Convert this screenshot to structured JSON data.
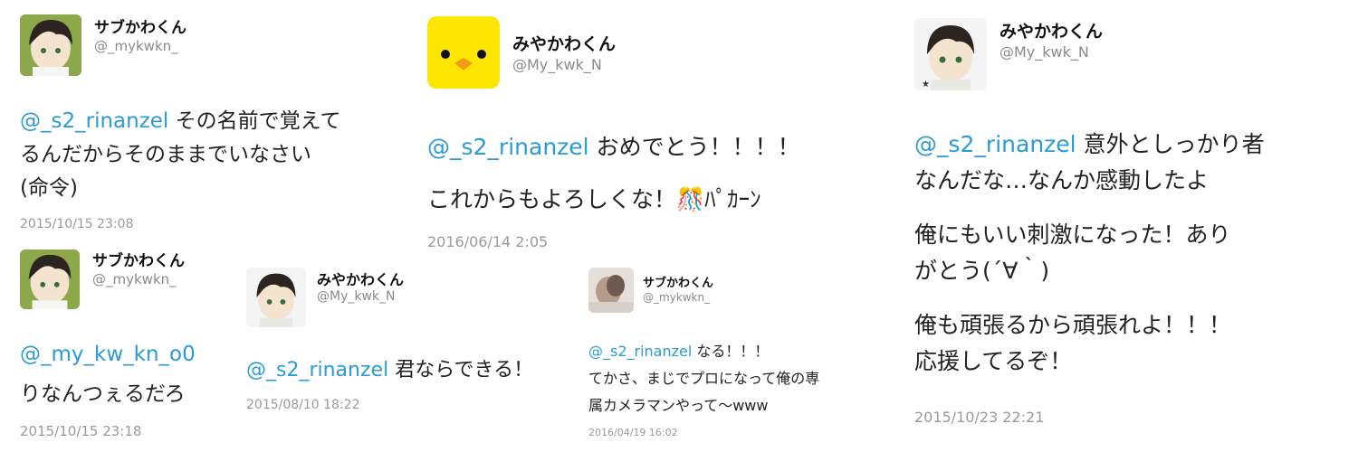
{
  "tweets": [
    {
      "name": "サブかわくん",
      "handle": "@_mykwkn_",
      "avatar": "anime-boy-avatar-green",
      "mention": "@_s2_rinanzel",
      "lines": [
        "その名前で覚えて",
        "るんだからそのままでいなさい",
        "(命令)"
      ],
      "timestamp": "2015/10/15 23:08"
    },
    {
      "name": "みやかわくん",
      "handle": "@My_kwk_N",
      "avatar": "yellow-chick-avatar",
      "mention": "@_s2_rinanzel",
      "lines": [
        "おめでとう！！！！",
        "これからもよろしくな！🎊ﾊﾟｶｰﾝ"
      ],
      "timestamp": "2016/06/14 2:05"
    },
    {
      "name": "みやかわくん",
      "handle": "@My_kwk_N",
      "avatar": "anime-boy-avatar-white",
      "mention": "@_s2_rinanzel",
      "paragraphs": [
        [
          "意外としっかり者",
          "なんだな…なんか感動したよ"
        ],
        [
          "俺にもいい刺激になった！あり",
          "がとう(´∀｀)"
        ],
        [
          "俺も頑張るから頑張れよ！！！",
          "応援してるぞ！"
        ]
      ],
      "timestamp": "2015/10/23 22:21"
    },
    {
      "name": "サブかわくん",
      "handle": "@_mykwkn_",
      "avatar": "anime-boy-avatar-green",
      "mention": "@_my_kw_kn_o0",
      "lines": [
        "りなんつぇるだろ"
      ],
      "timestamp": "2015/10/15 23:18"
    },
    {
      "name": "みやかわくん",
      "handle": "@My_kwk_N",
      "avatar": "anime-boy-avatar-white",
      "mention": "@_s2_rinanzel",
      "lines": [
        "君ならできる！"
      ],
      "timestamp": "2015/08/10 18:22"
    },
    {
      "name": "サブかわくん",
      "handle": "@_mykwkn_",
      "avatar": "photo-avatar",
      "mention": "@_s2_rinanzel",
      "lines": [
        "なる！！！",
        "てかさ、まじでプロになって俺の専",
        "属カメラマンやって〜www"
      ],
      "timestamp": "2016/04/19 16:02"
    }
  ],
  "colors": {
    "mention": "#2a9bd6",
    "timestamp": "#9a9a9a",
    "chick": "#ffe600"
  }
}
